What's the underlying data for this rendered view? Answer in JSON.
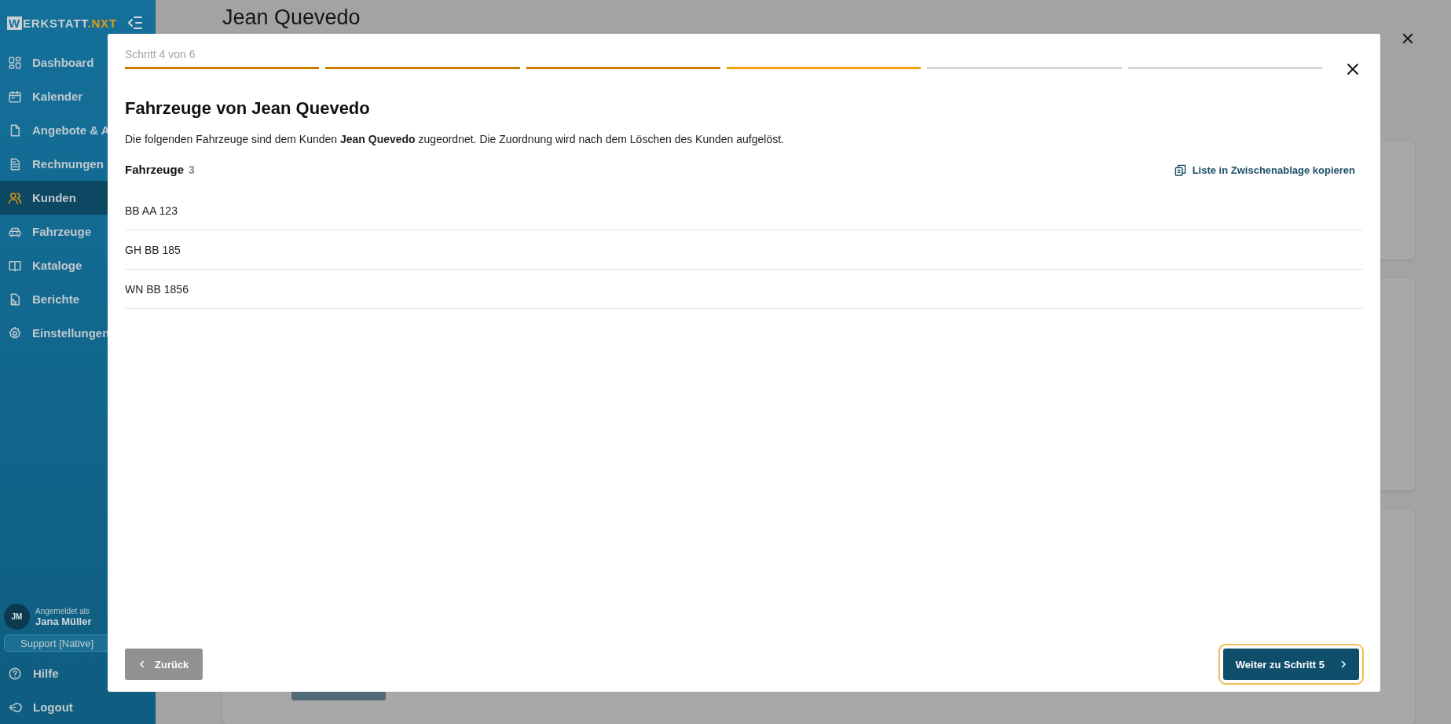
{
  "sidebar": {
    "logo": {
      "boxed": "W",
      "main": "ERKSTATT",
      "accent": ".NXT"
    },
    "items": [
      {
        "label": "Dashboard",
        "selected": false
      },
      {
        "label": "Kalender",
        "selected": false
      },
      {
        "label": "Angebote & A",
        "selected": false
      },
      {
        "label": "Rechnungen",
        "selected": false
      },
      {
        "label": "Kunden",
        "selected": true
      },
      {
        "label": "Fahrzeuge",
        "selected": false
      },
      {
        "label": "Kataloge",
        "selected": false
      },
      {
        "label": "Berichte",
        "selected": false
      },
      {
        "label": "Einstellungen",
        "selected": false
      }
    ],
    "user": {
      "initials": "JM",
      "caption": "Angemeldet als",
      "name": "Jana Müller"
    },
    "support_button": "Support [Native]",
    "bottom_items": [
      {
        "label": "Hilfe"
      },
      {
        "label": "Logout"
      }
    ]
  },
  "page": {
    "title": "Jean Quevedo"
  },
  "dialog": {
    "step_label": "Schritt 4 von 6",
    "steps": [
      {
        "kind": "done"
      },
      {
        "kind": "done"
      },
      {
        "kind": "done"
      },
      {
        "kind": "current"
      },
      {
        "kind": "todo"
      },
      {
        "kind": "todo"
      }
    ],
    "title": "Fahrzeuge von Jean Quevedo",
    "description": "Die folgenden Fahrzeuge sind dem Kunden **Jean Quevedo** zugeordnet. Die Zuordnung wird nach dem Löschen des Kunden aufgelöst.",
    "list_heading": "Fahrzeuge",
    "list_count": "3",
    "copy_link": "Liste in Zwischenablage kopieren",
    "vehicles": [
      "BB AA 123",
      "GH BB 185",
      "WN BB 1856"
    ],
    "back_button": "Zurück",
    "next_button": "Weiter zu Schritt 5"
  }
}
